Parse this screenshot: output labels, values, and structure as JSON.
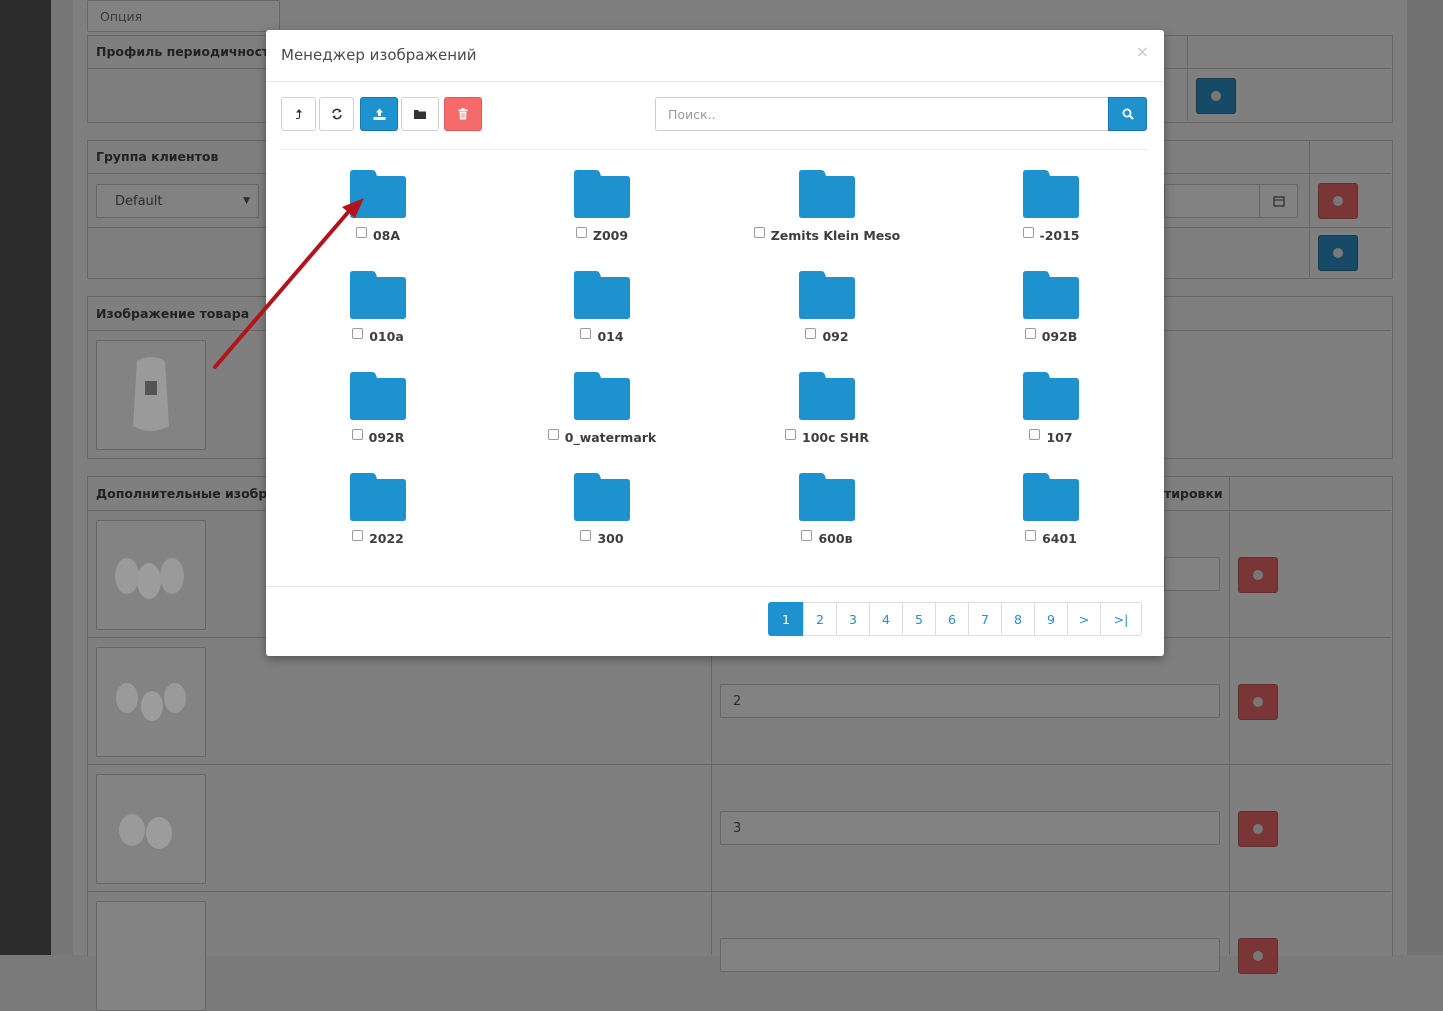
{
  "background": {
    "option_placeholder": "Опция",
    "periodicity_header": "Профиль периодичности",
    "customer_group_header": "Группа клиентов",
    "customer_group_value": "Default",
    "product_image_header": "Изображение товара",
    "additional_images_header": "Дополнительные изображ",
    "sort_order_header": "тировки",
    "sort_values": [
      "2",
      "3"
    ]
  },
  "modal": {
    "title": "Менеджер изображений",
    "close": "×",
    "toolbar": {
      "parent_icon": "level-up-icon",
      "refresh_icon": "refresh-icon",
      "upload_icon": "upload-icon",
      "folder_icon": "new-folder-icon",
      "delete_icon": "trash-icon"
    },
    "search": {
      "placeholder": "Поиск.."
    },
    "folders": [
      {
        "name": "08A"
      },
      {
        "name": "Z009"
      },
      {
        "name": "Zemits Klein Meso"
      },
      {
        "name": "-2015"
      },
      {
        "name": "010a"
      },
      {
        "name": "014"
      },
      {
        "name": "092"
      },
      {
        "name": "092B"
      },
      {
        "name": "092R"
      },
      {
        "name": "0_watermark"
      },
      {
        "name": "100c SHR"
      },
      {
        "name": "107"
      },
      {
        "name": "2022"
      },
      {
        "name": "300"
      },
      {
        "name": "600в"
      },
      {
        "name": "6401"
      }
    ],
    "pagination": [
      "1",
      "2",
      "3",
      "4",
      "5",
      "6",
      "7",
      "8",
      "9",
      ">",
      ">|"
    ],
    "active_page": "1"
  },
  "colors": {
    "primary": "#1e91cf",
    "danger": "#f56b6b",
    "folder": "#1e91cf",
    "annotation_arrow": "#b3141c"
  }
}
